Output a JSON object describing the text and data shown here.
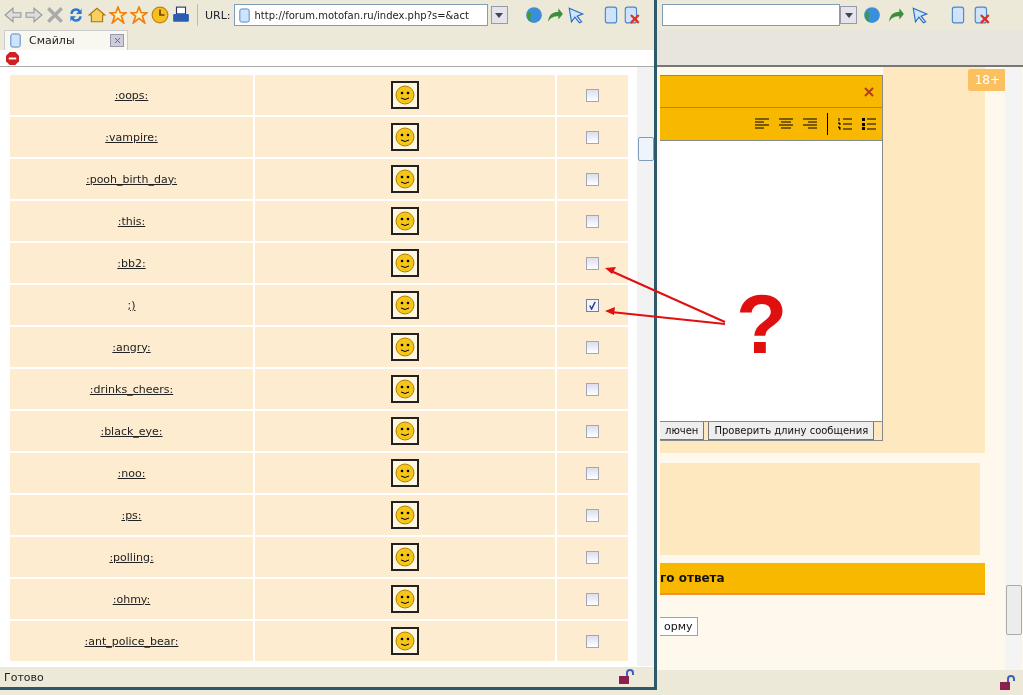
{
  "browser": {
    "url_label": "URL:",
    "url": "http://forum.motofan.ru/index.php?s=&act"
  },
  "popup": {
    "tab": "Смайлы",
    "rows": [
      {
        "code": ":oops:",
        "checked": false
      },
      {
        "code": ":vampire:",
        "checked": false
      },
      {
        "code": ":pooh_birth_day:",
        "checked": false
      },
      {
        "code": ":this:",
        "checked": false
      },
      {
        "code": ":bb2:",
        "checked": false
      },
      {
        "code": ";)",
        "checked": true
      },
      {
        "code": ":angry:",
        "checked": false
      },
      {
        "code": ":drinks_cheers:",
        "checked": false
      },
      {
        "code": ":black_eye:",
        "checked": false
      },
      {
        "code": ":noo:",
        "checked": false
      },
      {
        "code": ":ps:",
        "checked": false
      },
      {
        "code": ":polling:",
        "checked": false
      },
      {
        "code": ":ohmy:",
        "checked": false
      },
      {
        "code": ":ant_police_bear:",
        "checked": false
      }
    ],
    "status": "Готово"
  },
  "background": {
    "badge": "18+",
    "buttons": [
      "лючен",
      "Проверить длину сообщения"
    ],
    "section_title": "го ответа",
    "form_button": "орму"
  },
  "annotation": {
    "mark": "?"
  }
}
